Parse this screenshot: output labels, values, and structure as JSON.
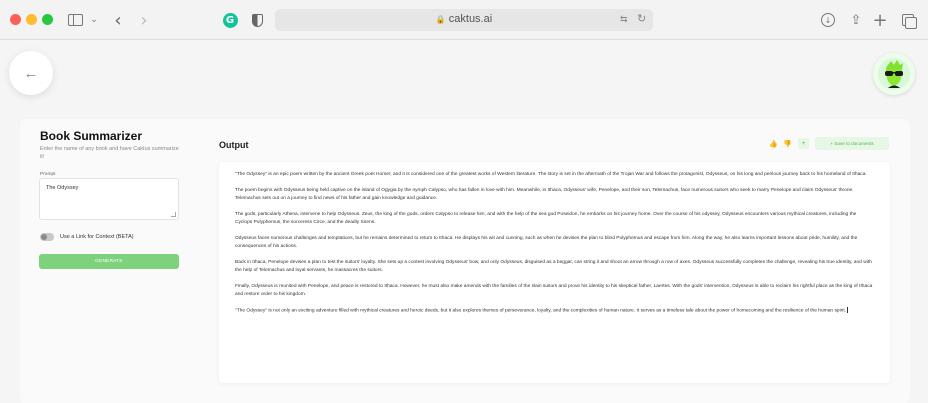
{
  "browser": {
    "url": "caktus.ai"
  },
  "page": {
    "back_icon": "arrow-left-icon",
    "avatar_icon": "sunglasses-avatar"
  },
  "tool": {
    "title": "Book Summarizer",
    "description": "Enter the name of any book and have Caktus summarize it!",
    "prompt_label": "Prompt",
    "prompt_value": "The Odyssey",
    "toggle_label": "Use a Link for Context (BETA)",
    "toggle_on": false,
    "generate_label": "GENERATE"
  },
  "output": {
    "title": "Output",
    "copy_label": "+",
    "save_label": "+ Save to documents",
    "paragraphs": [
      "\"The Odyssey\" is an epic poem written by the ancient Greek poet Homer, and it is considered one of the greatest works of Western literature. The story is set in the aftermath of the Trojan War and follows the protagonist, Odysseus, on his long and perilous journey back to his homeland of Ithaca.",
      "The poem begins with Odysseus being held captive on the island of Ogygia by the nymph Calypso, who has fallen in love with him. Meanwhile, in Ithaca, Odysseus' wife, Penelope, and their son, Telemachus, face numerous suitors who seek to marry Penelope and claim Odysseus' throne. Telemachus sets out on a journey to find news of his father and gain knowledge and guidance.",
      "The gods, particularly Athena, intervene to help Odysseus. Zeus, the king of the gods, orders Calypso to release him, and with the help of the sea god Poseidon, he embarks on his journey home. Over the course of his odyssey, Odysseus encounters various mythical creatures, including the Cyclops Polyphemus, the sorceress Circe, and the deadly Sirens.",
      "Odysseus faces numerous challenges and temptations, but he remains determined to return to Ithaca. He displays his wit and cunning, such as when he devises the plan to blind Polyphemus and escape from him. Along the way, he also learns important lessons about pride, humility, and the consequences of his actions.",
      "Back in Ithaca, Penelope devises a plan to test the suitors' loyalty. She sets up a contest involving Odysseus' bow, and only Odysseus, disguised as a beggar, can string it and shoot an arrow through a row of axes. Odysseus successfully completes the challenge, revealing his true identity, and with the help of Telemachus and loyal servants, he massacres the suitors.",
      "Finally, Odysseus is reunited with Penelope, and peace is restored to Ithaca. However, he must also make amends with the families of the slain suitors and prove his identity to his skeptical father, Laertes. With the gods' intervention, Odysseus is able to reclaim his rightful place as the king of Ithaca and restore order to his kingdom.",
      "\"The Odyssey\" is not only an exciting adventure filled with mythical creatures and heroic deeds, but it also explores themes of perseverance, loyalty, and the complexities of human nature. It serves as a timeless tale about the power of homecoming and the resilience of the human spirit."
    ]
  }
}
